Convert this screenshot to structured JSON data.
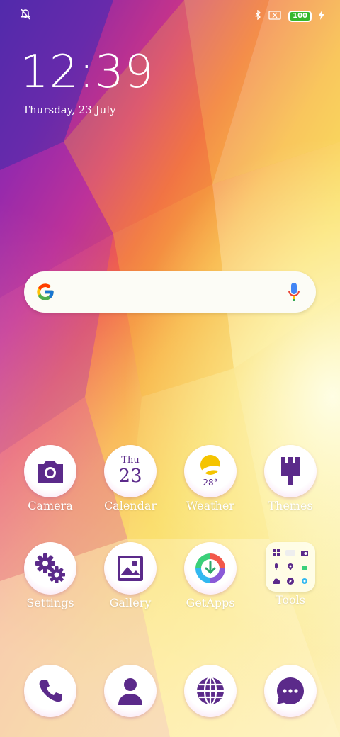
{
  "status_bar": {
    "left_icon": "alarm-off-icon",
    "right_icons": [
      "bluetooth-icon",
      "no-sim-icon"
    ],
    "battery_level": "100",
    "charging_icon": "charging-bolt-icon"
  },
  "lockclock": {
    "time": "12:39",
    "date": "Thursday, 23 July"
  },
  "search_bar": {
    "logo": "google-g-icon",
    "voice_icon": "microphone-icon"
  },
  "apps": [
    {
      "label": "Camera",
      "icon": "camera-icon"
    },
    {
      "label": "Calendar",
      "icon": "calendar-icon",
      "day": "Thu",
      "date": "23"
    },
    {
      "label": "Weather",
      "icon": "weather-sun-icon",
      "temperature": "28°"
    },
    {
      "label": "Themes",
      "icon": "paintbrush-icon"
    },
    {
      "label": "Settings",
      "icon": "gears-icon"
    },
    {
      "label": "Gallery",
      "icon": "image-icon"
    },
    {
      "label": "GetApps",
      "icon": "getapps-icon"
    },
    {
      "label": "Tools",
      "icon": "folder-icon"
    }
  ],
  "dock": [
    {
      "icon": "phone-icon"
    },
    {
      "icon": "contacts-icon"
    },
    {
      "icon": "browser-globe-icon"
    },
    {
      "icon": "messages-icon"
    }
  ],
  "colors": {
    "icon_purple": "#5b2a8a",
    "battery_green": "#36b82c"
  }
}
